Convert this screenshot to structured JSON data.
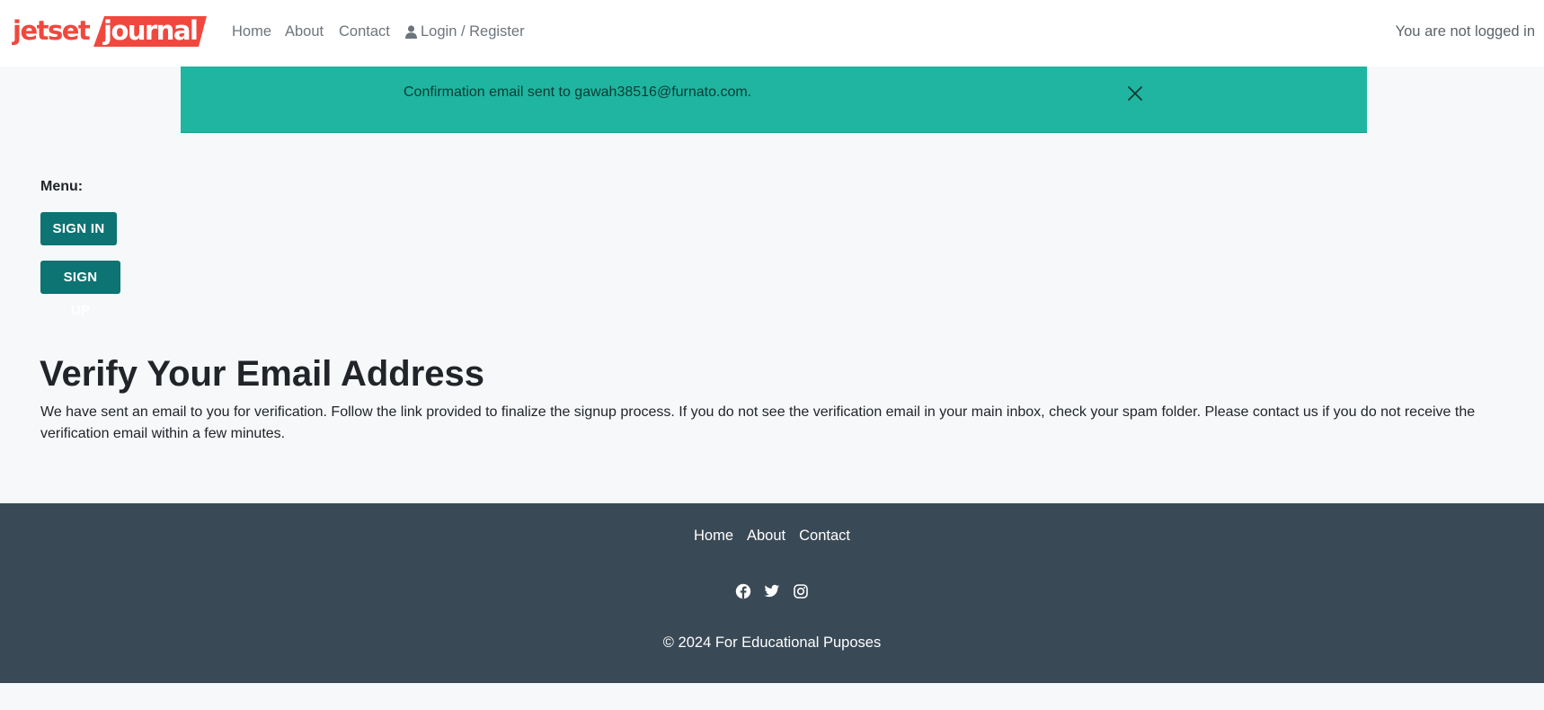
{
  "brand": {
    "part1": "jetset",
    "part2": "journal",
    "color": "#f0483e"
  },
  "nav": {
    "home": "Home",
    "about": "About",
    "contact": "Contact",
    "login": "Login / Register",
    "login_icon": "user-icon"
  },
  "login_status": "You are not logged in",
  "alert": {
    "message": "Confirmation email sent to gawah38516@furnato.com.",
    "close_icon": "close-icon",
    "color": "#1fb5a0"
  },
  "menu": {
    "label": "Menu:",
    "sign_in": "SIGN IN",
    "sign_up": "SIGN UP",
    "button_color": "#0d7373"
  },
  "main": {
    "title": "Verify Your Email Address",
    "body": "We have sent an email to you for verification. Follow the link provided to finalize the signup process. If you do not see the verification email in your main inbox, check your spam folder. Please contact us if you do not receive the verification email within a few minutes."
  },
  "footer": {
    "links": [
      "Home",
      "About",
      "Contact"
    ],
    "social_icons": [
      "facebook-icon",
      "twitter-icon",
      "instagram-icon"
    ],
    "copyright": "© 2024 For Educational Puposes",
    "background": "#3a4956"
  }
}
